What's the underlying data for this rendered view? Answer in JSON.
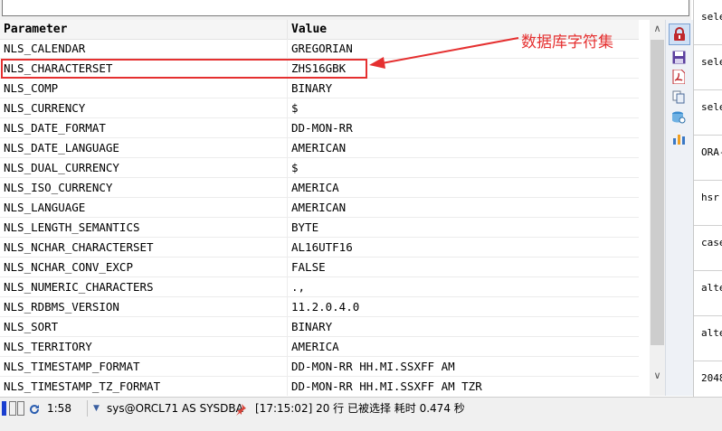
{
  "grid": {
    "columns": [
      "Parameter",
      "Value"
    ],
    "rows": [
      [
        "NLS_CALENDAR",
        "GREGORIAN"
      ],
      [
        "NLS_CHARACTERSET",
        "ZHS16GBK"
      ],
      [
        "NLS_COMP",
        "BINARY"
      ],
      [
        "NLS_CURRENCY",
        "$"
      ],
      [
        "NLS_DATE_FORMAT",
        "DD-MON-RR"
      ],
      [
        "NLS_DATE_LANGUAGE",
        "AMERICAN"
      ],
      [
        "NLS_DUAL_CURRENCY",
        "$"
      ],
      [
        "NLS_ISO_CURRENCY",
        "AMERICA"
      ],
      [
        "NLS_LANGUAGE",
        "AMERICAN"
      ],
      [
        "NLS_LENGTH_SEMANTICS",
        "BYTE"
      ],
      [
        "NLS_NCHAR_CHARACTERSET",
        "AL16UTF16"
      ],
      [
        "NLS_NCHAR_CONV_EXCP",
        "FALSE"
      ],
      [
        "NLS_NUMERIC_CHARACTERS",
        ".,"
      ],
      [
        "NLS_RDBMS_VERSION",
        "11.2.0.4.0"
      ],
      [
        "NLS_SORT",
        "BINARY"
      ],
      [
        "NLS_TERRITORY",
        "AMERICA"
      ],
      [
        "NLS_TIMESTAMP_FORMAT",
        "DD-MON-RR HH.MI.SSXFF AM"
      ],
      [
        "NLS_TIMESTAMP_TZ_FORMAT",
        "DD-MON-RR HH.MI.SSXFF AM TZR"
      ]
    ]
  },
  "annotation": {
    "text": "数据库字符集",
    "color": "#e53030"
  },
  "toolbar_icons": [
    "lock-icon",
    "save-icon",
    "pdf-icon",
    "copy-icon",
    "query-icon",
    "chart-icon"
  ],
  "right_panel": {
    "lines": [
      "sele",
      "sele",
      "sele",
      "ORA-",
      "hsr",
      "case",
      "alte",
      "alte",
      "2048"
    ]
  },
  "status": {
    "position": "1:58",
    "connection": "sys@ORCL71 AS SYSDBA",
    "message": "[17:15:02]  20 行 已被选择 耗时 0.474 秒"
  },
  "colors": {
    "accent": "#e53030",
    "toolbar_active": "#cfe0f5",
    "status_blue": "#1a3fd0"
  }
}
